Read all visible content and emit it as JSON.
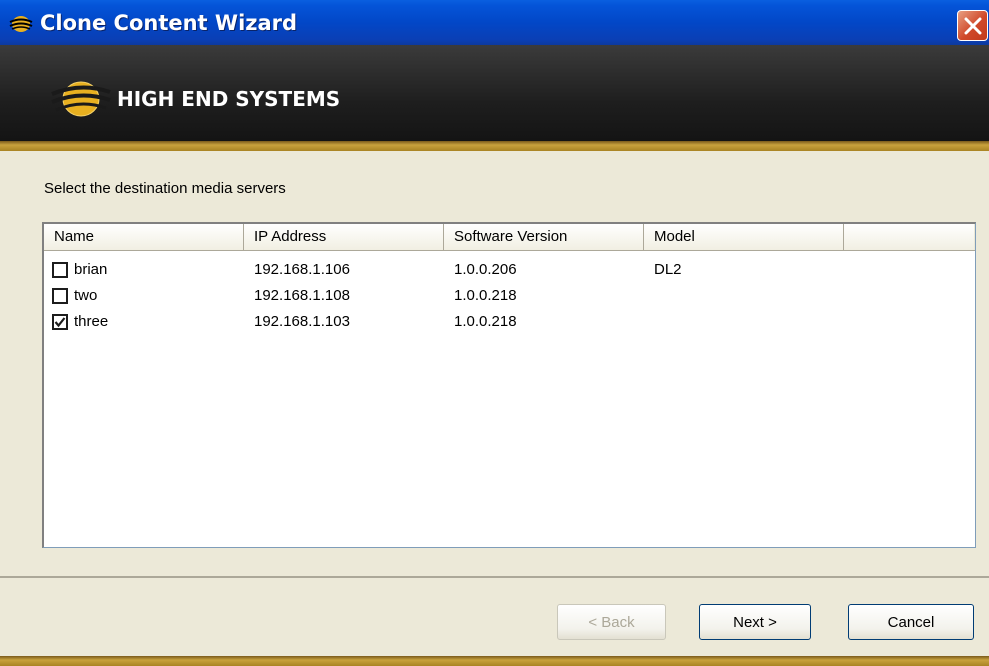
{
  "window": {
    "title": "Clone Content Wizard"
  },
  "banner": {
    "brand": "HIGH END SYSTEMS"
  },
  "instruction": "Select the destination media servers",
  "table": {
    "columns": [
      "Name",
      "IP Address",
      "Software Version",
      "Model",
      ""
    ],
    "rows": [
      {
        "name": "brian",
        "ip": "192.168.1.106",
        "version": "1.0.0.206",
        "model": "DL2",
        "checked": false
      },
      {
        "name": "two",
        "ip": "192.168.1.108",
        "version": "1.0.0.218",
        "model": "",
        "checked": false
      },
      {
        "name": "three",
        "ip": "192.168.1.103",
        "version": "1.0.0.218",
        "model": "",
        "checked": true
      }
    ]
  },
  "buttons": {
    "back": "< Back",
    "next": "Next >",
    "cancel": "Cancel"
  },
  "colors": {
    "titlebar": "#0454d8",
    "banner": "#1e1e1e",
    "accent_gold": "#c9a23d",
    "close": "#d0492a"
  },
  "icons": {
    "title_icon": "high-end-systems-logo-icon",
    "close": "close-icon",
    "checkbox": "checkbox-icon"
  }
}
